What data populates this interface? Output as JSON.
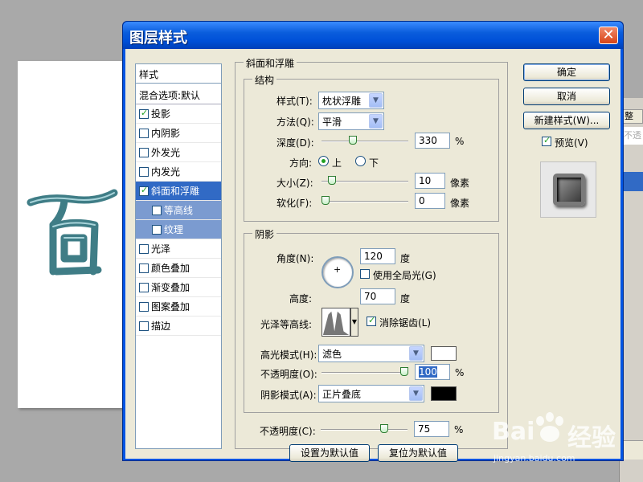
{
  "dialog": {
    "title": "图层样式",
    "close_label": "✕",
    "style_list": {
      "header": "样式",
      "blend_options": "混合选项:默认",
      "items": [
        {
          "label": "投影",
          "checked": true
        },
        {
          "label": "内阴影",
          "checked": false
        },
        {
          "label": "外发光",
          "checked": false
        },
        {
          "label": "内发光",
          "checked": false
        },
        {
          "label": "斜面和浮雕",
          "checked": true,
          "selected": true
        },
        {
          "label": "等高线",
          "checked": false,
          "sub": true
        },
        {
          "label": "纹理",
          "checked": false,
          "sub": true
        },
        {
          "label": "光泽",
          "checked": false
        },
        {
          "label": "颜色叠加",
          "checked": false
        },
        {
          "label": "渐变叠加",
          "checked": false
        },
        {
          "label": "图案叠加",
          "checked": false
        },
        {
          "label": "描边",
          "checked": false
        }
      ]
    },
    "bevel": {
      "section_title": "斜面和浮雕",
      "structure": {
        "title": "结构",
        "style_label": "样式(T):",
        "style_value": "枕状浮雕",
        "technique_label": "方法(Q):",
        "technique_value": "平滑",
        "depth_label": "深度(D):",
        "depth_value": "330",
        "depth_unit": "%",
        "depth_slider_fraction": 0.35,
        "direction_label": "方向:",
        "direction_up": "上",
        "direction_down": "下",
        "size_label": "大小(Z):",
        "size_value": "10",
        "size_unit": "像素",
        "size_slider_fraction": 0.08,
        "soften_label": "软化(F):",
        "soften_value": "0",
        "soften_unit": "像素",
        "soften_slider_fraction": 0.0
      },
      "shading": {
        "title": "阴影",
        "angle_label": "角度(N):",
        "angle_value": "120",
        "angle_unit": "度",
        "global_light_label": "使用全局光(G)",
        "altitude_label": "高度:",
        "altitude_value": "70",
        "altitude_unit": "度",
        "gloss_contour_label": "光泽等高线:",
        "antialias_label": "消除锯齿(L)",
        "highlight_mode_label": "高光模式(H):",
        "highlight_mode_value": "滤色",
        "highlight_color": "#ffffff",
        "highlight_opacity_label": "不透明度(O):",
        "highlight_opacity_value": "100",
        "highlight_opacity_unit": "%",
        "highlight_slider_fraction": 1.0,
        "shadow_mode_label": "阴影模式(A):",
        "shadow_mode_value": "正片叠底",
        "shadow_color": "#000000",
        "shadow_opacity_label": "不透明度(C):",
        "shadow_opacity_value": "75",
        "shadow_opacity_unit": "%",
        "shadow_slider_fraction": 0.75
      },
      "make_default": "设置为默认值",
      "reset_default": "复位为默认值"
    },
    "buttons": {
      "ok": "确定",
      "cancel": "取消",
      "new_style": "新建样式(W)...",
      "preview_label": "预览(V)"
    }
  },
  "background": {
    "panel_tab": "整",
    "panel_hint": "不透",
    "watermark": "Bai",
    "watermark_cn": "经验",
    "watermark_url": "jingyan.baidu.com"
  }
}
